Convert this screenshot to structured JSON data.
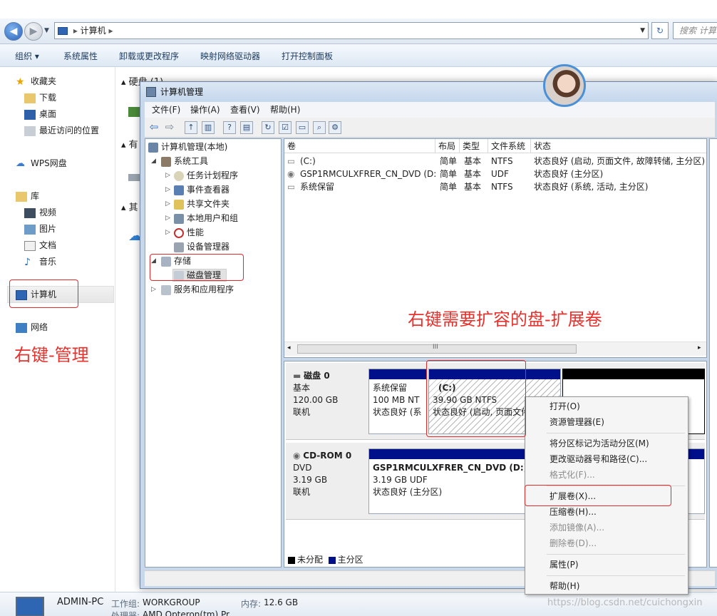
{
  "explorer": {
    "breadcrumb": [
      "计算机"
    ],
    "search_placeholder": "搜索 计算",
    "commands": [
      "组织 ▾",
      "系统属性",
      "卸载或更改程序",
      "映射网络驱动器",
      "打开控制面板"
    ],
    "nav": {
      "favorites": "收藏夹",
      "favorites_items": [
        "下载",
        "桌面",
        "最近访问的位置"
      ],
      "wps": "WPS网盘",
      "library": "库",
      "library_items": [
        "视频",
        "图片",
        "文档",
        "音乐"
      ],
      "computer": "计算机",
      "network": "网络"
    },
    "main": {
      "section1": "硬盘 (1)",
      "section2": "有",
      "section3": "其"
    },
    "details": {
      "pc_name": "ADMIN-PC",
      "workgroup_label": "工作组:",
      "workgroup": "WORKGROUP",
      "memory_label": "内存:",
      "memory": "12.6 GB",
      "cpu_label": "处理器:",
      "cpu": "AMD Opteron(tm) Pr"
    }
  },
  "mmc": {
    "title": "计算机管理",
    "menu": [
      "文件(F)",
      "操作(A)",
      "查看(V)",
      "帮助(H)"
    ],
    "tree": {
      "root": "计算机管理(本地)",
      "system_tools": "系统工具",
      "task_scheduler": "任务计划程序",
      "event_viewer": "事件查看器",
      "shared_folders": "共享文件夹",
      "local_users": "本地用户和组",
      "performance": "性能",
      "device_manager": "设备管理器",
      "storage": "存储",
      "disk_management": "磁盘管理",
      "services_apps": "服务和应用程序"
    },
    "columns": [
      "卷",
      "布局",
      "类型",
      "文件系统",
      "状态"
    ],
    "volumes": [
      {
        "name": "(C:)",
        "layout": "简单",
        "type": "基本",
        "fs": "NTFS",
        "status": "状态良好 (启动, 页面文件, 故障转储, 主分区)"
      },
      {
        "name": "GSP1RMCULXFRER_CN_DVD (D:)",
        "layout": "简单",
        "type": "基本",
        "fs": "UDF",
        "status": "状态良好 (主分区)"
      },
      {
        "name": "系统保留",
        "layout": "简单",
        "type": "基本",
        "fs": "NTFS",
        "status": "状态良好 (系统, 活动, 主分区)"
      }
    ],
    "scroll_mark": "III",
    "disks": [
      {
        "label": "磁盘 0",
        "kind": "基本",
        "size": "120.00 GB",
        "state": "联机",
        "partitions": [
          {
            "name": "系统保留",
            "size": "100 MB NT",
            "status": "状态良好 (系"
          },
          {
            "name": "(C:)",
            "size": "39.90 GB NTFS",
            "status": "状态良好 (启动, 页面文件"
          }
        ]
      },
      {
        "label": "CD-ROM 0",
        "kind": "DVD",
        "size": "3.19 GB",
        "state": "联机",
        "partitions": [
          {
            "name": "GSP1RMCULXFRER_CN_DVD  (D:)",
            "size": "3.19 GB UDF",
            "status": "状态良好 (主分区)"
          }
        ]
      }
    ],
    "legend": [
      "未分配",
      "主分区"
    ],
    "colors": {
      "primary_partition": "#000f8a",
      "unallocated": "#000000"
    }
  },
  "context_menu": {
    "items": [
      {
        "label": "打开(O)",
        "enabled": true
      },
      {
        "label": "资源管理器(E)",
        "enabled": true
      },
      {
        "label": "将分区标记为活动分区(M)",
        "enabled": true
      },
      {
        "label": "更改驱动器号和路径(C)...",
        "enabled": true
      },
      {
        "label": "格式化(F)...",
        "enabled": false
      },
      {
        "label": "扩展卷(X)...",
        "enabled": true
      },
      {
        "label": "压缩卷(H)...",
        "enabled": true
      },
      {
        "label": "添加镜像(A)...",
        "enabled": false
      },
      {
        "label": "删除卷(D)...",
        "enabled": false
      },
      {
        "label": "属性(P)",
        "enabled": true
      },
      {
        "label": "帮助(H)",
        "enabled": true
      }
    ]
  },
  "annotations": {
    "right_click_manage": "右键-管理",
    "right_click_extend": "右键需要扩容的盘-扩展卷",
    "color": "#e8312c"
  },
  "watermark": "https://blog.csdn.net/cuichongxin"
}
